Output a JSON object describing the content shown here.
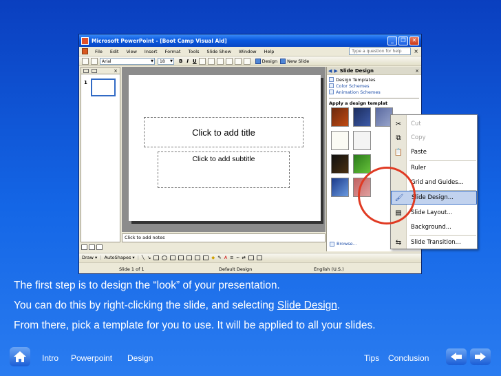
{
  "window": {
    "title": "Microsoft PowerPoint - [Boot Camp Visual Aid]",
    "minimize": "_",
    "restore": "❐",
    "close": "✕"
  },
  "menu": {
    "items": [
      "File",
      "Edit",
      "View",
      "Insert",
      "Format",
      "Tools",
      "Slide Show",
      "Window",
      "Help"
    ],
    "help_placeholder": "Type a question for help",
    "close": "×"
  },
  "toolbar": {
    "font": "Arial",
    "size": "18",
    "bold": "B",
    "italic": "I",
    "underline": "U",
    "design": "Design",
    "new_slide": "New Slide"
  },
  "slides_pane": {
    "slide_number": "1"
  },
  "slide": {
    "title_placeholder": "Click to add title",
    "subtitle_placeholder": "Click to add subtitle"
  },
  "notes": {
    "placeholder": "Click to add notes"
  },
  "drawbar": {
    "draw": "Draw ▾",
    "autoshapes": "AutoShapes ▾"
  },
  "status": {
    "slide": "Slide 1 of 1",
    "design": "Default Design",
    "language": "English (U.S.)"
  },
  "task_pane": {
    "title": "Slide Design",
    "links": [
      "Design Templates",
      "Color Schemes",
      "Animation Schemes"
    ],
    "apply_label": "Apply a design templat",
    "browse": "Browse..."
  },
  "context_menu": {
    "items": [
      {
        "label": "Cut",
        "icon": "scissors-icon",
        "disabled": true
      },
      {
        "label": "Copy",
        "icon": "copy-icon",
        "disabled": true
      },
      {
        "label": "Paste",
        "icon": "paste-icon",
        "disabled": false
      },
      {
        "label": "Ruler",
        "icon": "",
        "disabled": false
      },
      {
        "label": "Grid and Guides...",
        "icon": "",
        "disabled": false
      },
      {
        "label": "Slide Design...",
        "icon": "slide-design-icon",
        "disabled": false,
        "highlighted": true
      },
      {
        "label": "Slide Layout...",
        "icon": "slide-layout-icon",
        "disabled": false
      },
      {
        "label": "Background...",
        "icon": "",
        "disabled": false
      },
      {
        "label": "Slide Transition...",
        "icon": "slide-transition-icon",
        "disabled": false
      }
    ]
  },
  "captions": {
    "line1": "The first step is to design the “look” of your presentation.",
    "line2_pre": "You can do this by right-clicking the slide, and selecting ",
    "line2_link": "Slide Design",
    "line2_post": ".",
    "line3": "From there, pick a template for you to use.  It will be applied to all your slides."
  },
  "nav": {
    "intro": "Intro",
    "powerpoint": "Powerpoint",
    "design": "Design",
    "tips": "Tips",
    "conclusion": "Conclusion"
  },
  "colors": {
    "background_top": "#0a3fbf",
    "highlight_circle": "#e03a23",
    "menu_highlight": "#c1d2ee"
  }
}
